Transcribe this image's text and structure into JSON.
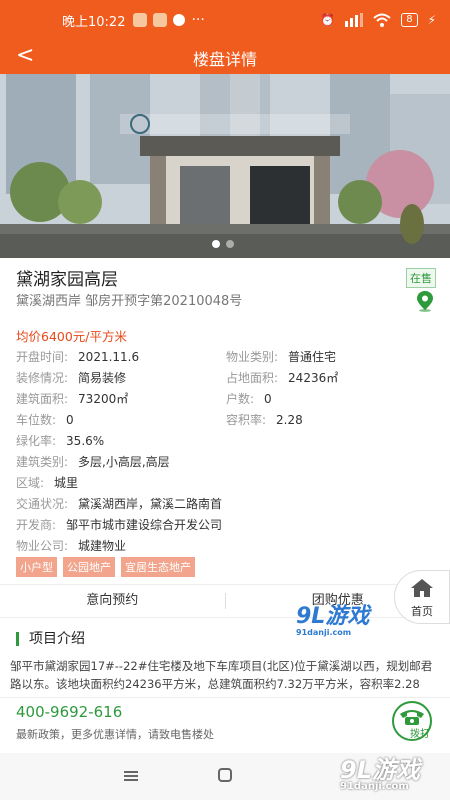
{
  "status_bar": {
    "time": "晚上10:22",
    "icons": [
      "notification-icons",
      "more-dots-icon",
      "alarm-icon",
      "hd-signal-icon",
      "wifi-icon",
      "battery-icon",
      "charging-icon"
    ],
    "battery": "8",
    "dots": "···"
  },
  "nav": {
    "title": "楼盘详情",
    "back_icon": "back-arrow-icon"
  },
  "carousel": {
    "count": 2,
    "active": 0
  },
  "property": {
    "name": "黛湖家园高层",
    "status": "在售",
    "subtitle": "黛溪湖西岸 邹房开预字第20210048号",
    "price": "均价6400元/平方米"
  },
  "details": {
    "open_date_label": "开盘时间:",
    "open_date": "2021.11.6",
    "property_type_label": "物业类别:",
    "property_type": "普通住宅",
    "decoration_label": "装修情况:",
    "decoration": "简易装修",
    "land_area_label": "占地面积:",
    "land_area": "24236㎡",
    "building_area_label": "建筑面积:",
    "building_area": "73200㎡",
    "households_label": "户数:",
    "households": "0",
    "parking_label": "车位数:",
    "parking": "0",
    "plot_ratio_label": "容积率:",
    "plot_ratio": "2.28",
    "green_ratio_label": "绿化率:",
    "green_ratio": "35.6%",
    "building_type_label": "建筑类别:",
    "building_type": "多层,小高层,高层",
    "region_label": "区域:",
    "region": "城里",
    "traffic_label": "交通状况:",
    "traffic": "黛溪湖西岸，黛溪二路南首",
    "developer_label": "开发商:",
    "developer": "邹平市城市建设综合开发公司",
    "management_label": "物业公司:",
    "management": "城建物业"
  },
  "tags": [
    "小户型",
    "公园地产",
    "宜居生态地产"
  ],
  "tabs": {
    "reserve": "意向预约",
    "group": "团购优惠"
  },
  "home_button": {
    "label": "首页"
  },
  "intro": {
    "title": "项目介绍",
    "text": "邹平市黛湖家园17#--22#住宅楼及地下车库项目(北区)位于黛溪湖以西，规划邮君路以东。该地块面积约24236平方米，总建筑面积约7.32万平方米，容积率2.28"
  },
  "call": {
    "phone": "400-9692-616",
    "subtitle": "最新政策，更多优惠详情，请致电售楼处",
    "button": "拨打"
  },
  "watermark": {
    "logo": "9L游戏",
    "domain": "91danji.com"
  },
  "colors": {
    "brand": "#f05b1e",
    "accent_green": "#2e9a3c",
    "price_red": "#e84a1a",
    "tag_bg": "#f2a58c"
  }
}
